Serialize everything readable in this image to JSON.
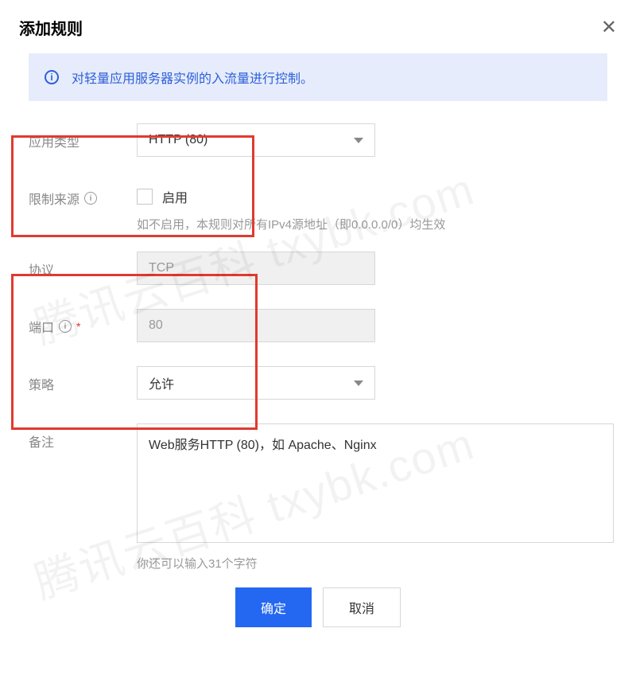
{
  "header": {
    "title": "添加规则"
  },
  "banner": {
    "text": "对轻量应用服务器实例的入流量进行控制。"
  },
  "form": {
    "app_type": {
      "label": "应用类型",
      "value": "HTTP (80)"
    },
    "source": {
      "label": "限制来源",
      "checkbox_label": "启用",
      "help": "如不启用，本规则对所有IPv4源地址（即0.0.0.0/0）均生效"
    },
    "protocol": {
      "label": "协议",
      "value": "TCP"
    },
    "port": {
      "label": "端口",
      "value": "80"
    },
    "policy": {
      "label": "策略",
      "value": "允许"
    },
    "remark": {
      "label": "备注",
      "value": "Web服务HTTP (80)，如 Apache、Nginx",
      "char_count": "你还可以输入31个字符"
    }
  },
  "footer": {
    "confirm": "确定",
    "cancel": "取消"
  },
  "watermark": "腾讯云百科 txybk.com"
}
